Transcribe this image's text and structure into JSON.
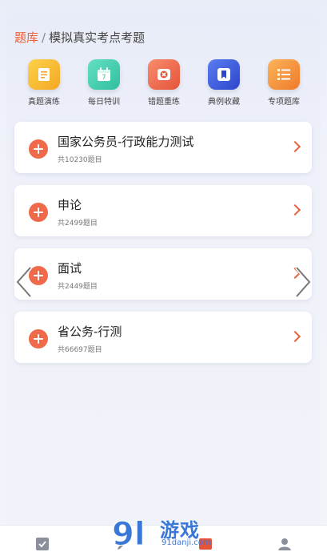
{
  "breadcrumb": {
    "root": "题库",
    "separator": "/",
    "current": "模拟真实考点考题"
  },
  "quick_actions": [
    {
      "label": "真题演练",
      "icon": "document-icon",
      "color": "#f6b830"
    },
    {
      "label": "每日特训",
      "icon": "calendar-icon",
      "color": "#3ecfb0"
    },
    {
      "label": "错题重练",
      "icon": "error-x-icon",
      "color": "#ef6a4a"
    },
    {
      "label": "典例收藏",
      "icon": "bookmark-icon",
      "color": "#3f63e4"
    },
    {
      "label": "专项题库",
      "icon": "list-icon",
      "color": "#f59245"
    }
  ],
  "question_banks": [
    {
      "title": "国家公务员-行政能力测试",
      "count": "共10230题目"
    },
    {
      "title": "申论",
      "count": "共2499题目"
    },
    {
      "title": "面试",
      "count": "共2449题目"
    },
    {
      "title": "省公务-行测",
      "count": "共66697题目"
    }
  ],
  "watermark": {
    "main": "游戏",
    "sub": "91danji.com"
  },
  "colors": {
    "accent": "#e8623e",
    "plus": "#ef6a4a",
    "watermark": "#3a78d8"
  }
}
